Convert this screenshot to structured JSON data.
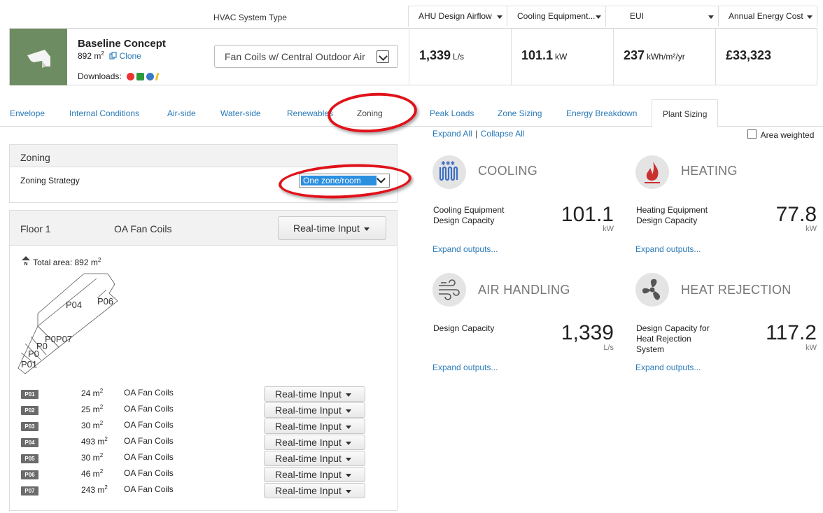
{
  "header": {
    "hvac_label": "HVAC System Type",
    "metric_tabs": [
      {
        "label": "AHU Design Airflow"
      },
      {
        "label": "Cooling Equipment..."
      },
      {
        "label": "EUI"
      },
      {
        "label": "Annual Energy Cost"
      }
    ],
    "project": {
      "name": "Baseline Concept",
      "area_value": "892 m",
      "area_sup": "2",
      "clone_label": "Clone",
      "downloads_label": "Downloads:"
    },
    "system_select": {
      "value": "Fan Coils w/ Central Outdoor Air"
    },
    "metrics": [
      {
        "value": "1,339",
        "unit": "L/s"
      },
      {
        "value": "101.1",
        "unit": "kW"
      },
      {
        "value": "237",
        "unit": "kWh/m²/yr"
      },
      {
        "value": "£33,323",
        "unit": ""
      }
    ]
  },
  "tabs": [
    {
      "label": "Envelope"
    },
    {
      "label": "Internal Conditions"
    },
    {
      "label": "Air-side"
    },
    {
      "label": "Water-side"
    },
    {
      "label": "Renewables"
    },
    {
      "label": "Zoning"
    },
    {
      "label": "Peak Loads"
    },
    {
      "label": "Zone Sizing"
    },
    {
      "label": "Energy Breakdown"
    },
    {
      "label": "Plant Sizing"
    }
  ],
  "zoning_panel": {
    "title": "Zoning",
    "strategy_label": "Zoning Strategy",
    "strategy_value": "One zone/room"
  },
  "floor_panel": {
    "floor_label": "Floor 1",
    "system_label": "OA Fan Coils",
    "button_label": "Real-time Input",
    "total_area": "Total area: 892 m",
    "total_area_sup": "2",
    "north_label": "N",
    "plan_labels": [
      "P04",
      "P06",
      "P0P07",
      "P0",
      "P0",
      "P01"
    ],
    "zones": [
      {
        "tag": "P01",
        "area": "24 m",
        "sys": "OA Fan Coils",
        "btn": "Real-time Input"
      },
      {
        "tag": "P02",
        "area": "25 m",
        "sys": "OA Fan Coils",
        "btn": "Real-time Input"
      },
      {
        "tag": "P03",
        "area": "30 m",
        "sys": "OA Fan Coils",
        "btn": "Real-time Input"
      },
      {
        "tag": "P04",
        "area": "493 m",
        "sys": "OA Fan Coils",
        "btn": "Real-time Input"
      },
      {
        "tag": "P05",
        "area": "30 m",
        "sys": "OA Fan Coils",
        "btn": "Real-time Input"
      },
      {
        "tag": "P06",
        "area": "46 m",
        "sys": "OA Fan Coils",
        "btn": "Real-time Input"
      },
      {
        "tag": "P07",
        "area": "243 m",
        "sys": "OA Fan Coils",
        "btn": "Real-time Input"
      }
    ],
    "sup": "2"
  },
  "results": {
    "expand_all": "Expand All",
    "separator": "|",
    "collapse_all": "Collapse All",
    "area_weighted": "Area weighted",
    "expand_outputs": "Expand outputs...",
    "cards": [
      {
        "title": "COOLING",
        "label_1": "Cooling Equipment",
        "label_2": "Design Capacity",
        "label_3": "",
        "value": "101.1",
        "unit": "kW"
      },
      {
        "title": "HEATING",
        "label_1": "Heating Equipment",
        "label_2": "Design Capacity",
        "label_3": "",
        "value": "77.8",
        "unit": "kW"
      },
      {
        "title": "AIR HANDLING",
        "label_1": "Design Capacity",
        "label_2": "",
        "label_3": "",
        "value": "1,339",
        "unit": "L/s"
      },
      {
        "title": "HEAT REJECTION",
        "label_1": "Design Capacity for",
        "label_2": "Heat Rejection",
        "label_3": "System",
        "value": "117.2",
        "unit": "kW"
      }
    ]
  },
  "colors": {
    "link": "#2a7ab8",
    "annotation": "#e0121a",
    "heating_icon": "#c8312e",
    "cooling_icon": "#3d6fc4"
  }
}
